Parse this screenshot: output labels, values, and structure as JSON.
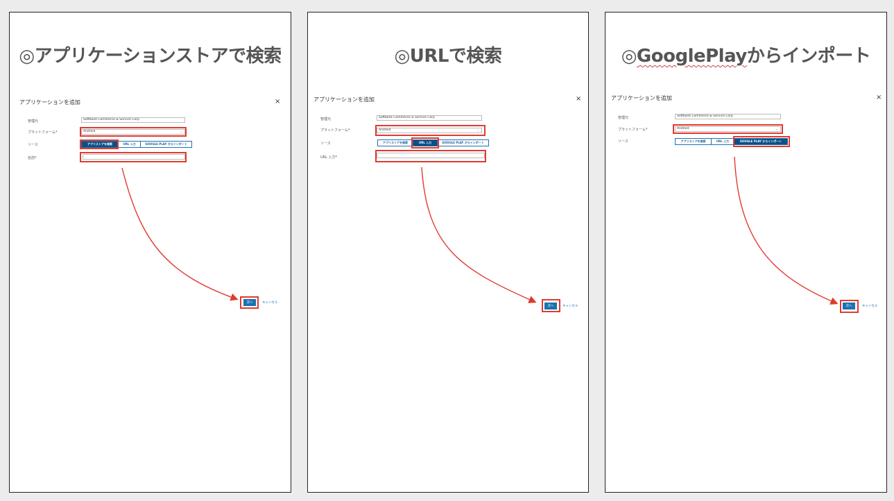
{
  "panels": [
    {
      "heading_mark": "◎",
      "heading_text": "アプリケーションストアで検索",
      "dialog_title": "アプリケーションを追加",
      "close_glyph": "×",
      "fields": {
        "account_label": "管理元",
        "account_value": "Softbank Commerce & Service Corp",
        "platform_label": "プラットフォーム",
        "platform_value": "Android",
        "source_label": "ソース",
        "fourth_label": "名前"
      },
      "sources": [
        "アプリストアを検索",
        "URL 入力",
        "GOOGLE PLAY からインポート"
      ],
      "active_source": 0,
      "next_label": "次へ",
      "cancel_label": "キャンセル"
    },
    {
      "heading_mark": "◎",
      "heading_text": "URLで検索",
      "dialog_title": "アプリケーションを追加",
      "close_glyph": "×",
      "fields": {
        "account_label": "管理元",
        "account_value": "Softbank Commerce & Service Corp",
        "platform_label": "プラットフォーム",
        "platform_value": "Android",
        "source_label": "ソース",
        "fourth_label": "URL 入力"
      },
      "sources": [
        "アプリストアを検索",
        "URL 入力",
        "GOOGLE PLAY からインポート"
      ],
      "active_source": 1,
      "next_label": "次へ",
      "cancel_label": "キャンセル"
    },
    {
      "heading_mark": "◎",
      "heading_text": "GooglePlayからインポート",
      "heading_wavy": "GooglePlay",
      "heading_rest": "からインポート",
      "dialog_title": "アプリケーションを追加",
      "close_glyph": "×",
      "fields": {
        "account_label": "管理元",
        "account_value": "Softbank Commerce & Service Corp",
        "platform_label": "プラットフォーム",
        "platform_value": "Android",
        "source_label": "ソース"
      },
      "sources": [
        "アプリストアを検索",
        "URL 入力",
        "GOOGLE PLAY からインポート"
      ],
      "active_source": 2,
      "next_label": "次へ",
      "cancel_label": "キャンセル"
    }
  ],
  "colors": {
    "highlight": "#e03a2e",
    "primary": "#1a73b0",
    "active_tab": "#0b4f86"
  }
}
